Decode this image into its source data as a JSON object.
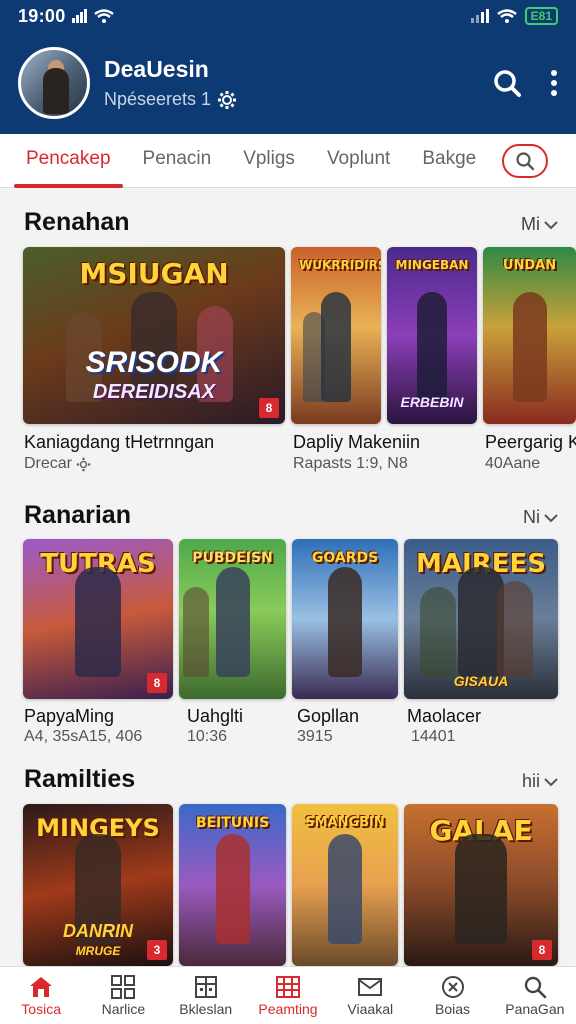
{
  "status_bar": {
    "time": "19:00",
    "battery": "E81"
  },
  "header": {
    "name": "DeaUesin",
    "subtitle": "Npéseerets 1"
  },
  "tabs": [
    {
      "label": "Pencakep",
      "active": true
    },
    {
      "label": "Penacin",
      "active": false
    },
    {
      "label": "Vpligs",
      "active": false
    },
    {
      "label": "Voplunt",
      "active": false
    },
    {
      "label": "Bakge",
      "active": false
    }
  ],
  "sections": [
    {
      "title": "Renahan",
      "more": "Mi",
      "items": [
        {
          "art_title": "MSIUGAN",
          "art_sub": "SRISODK",
          "art_sub2": "DEREIDISAX",
          "badge": "8",
          "caption": "Kaniagdang tHetrnngan",
          "sub": "Drecar"
        },
        {
          "art_title": "WUKRRIDIRS",
          "caption": "Dapliy Makeniin",
          "sub": "Rapasts 1:9, N8"
        },
        {
          "art_title": "MINGEBAN",
          "art_sub": "ERBEBIN",
          "caption": "",
          "sub": ""
        },
        {
          "art_title": "UNDAN",
          "caption": "Peergarig K",
          "sub": "40Aane"
        }
      ]
    },
    {
      "title": "Ranarian",
      "more": "Ni",
      "items": [
        {
          "art_title": "TUTRAS",
          "badge": "8",
          "caption": "PapyaMing",
          "sub": "A4, 35sA15, 406"
        },
        {
          "art_title": "PUBDEISN",
          "caption": "Uahglti",
          "sub": "10:36"
        },
        {
          "art_title": "GOARDS",
          "caption": "Gopllan",
          "sub": "3915"
        },
        {
          "art_title": "MAIREES",
          "art_sub": "GISAUA",
          "caption": "Maolacer",
          "sub": "14401"
        }
      ]
    },
    {
      "title": "Ramilties",
      "more": "hii",
      "items": [
        {
          "art_title": "MINGEYS",
          "art_sub": "DANRIN",
          "art_sub2": "MRUGE",
          "badge": "3",
          "caption": "",
          "sub": ""
        },
        {
          "art_title": "BEITUNIS",
          "caption": "",
          "sub": ""
        },
        {
          "art_title": "SMANGBIN",
          "caption": "",
          "sub": ""
        },
        {
          "art_title": "GALAE",
          "badge": "8",
          "caption": "",
          "sub": ""
        }
      ]
    }
  ],
  "bottom_nav": [
    {
      "label": "Tosica",
      "icon": "home-icon",
      "active": true
    },
    {
      "label": "Narlice",
      "icon": "grid-icon",
      "active": false
    },
    {
      "label": "Bkleslan",
      "icon": "building-icon",
      "active": false
    },
    {
      "label": "Peamting",
      "icon": "calendar-icon",
      "active": true
    },
    {
      "label": "Viaakal",
      "icon": "mail-icon",
      "active": false
    },
    {
      "label": "Boias",
      "icon": "close-circle-icon",
      "active": false
    },
    {
      "label": "PanaGan",
      "icon": "search-icon",
      "active": false
    }
  ],
  "colors": {
    "header_bg": "#0d3a73",
    "accent": "#d8292f"
  }
}
